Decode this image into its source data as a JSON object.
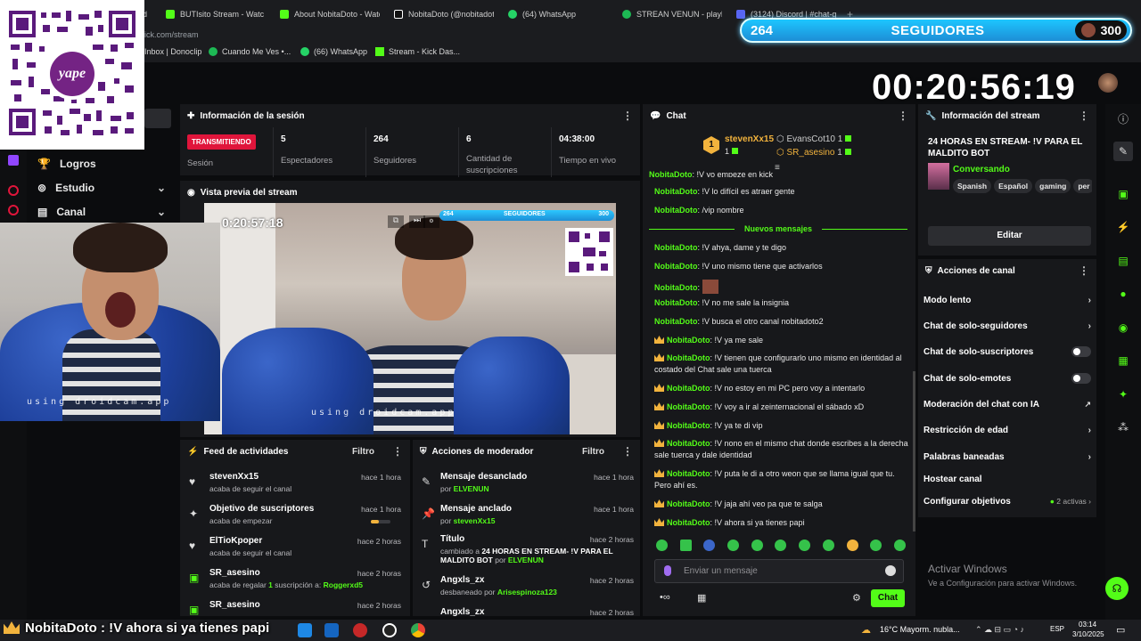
{
  "browser": {
    "tabs": [
      {
        "label": "d",
        "color": "#e8453c"
      },
      {
        "label": "BUTIsito Stream - Watch",
        "color": "#53fc18"
      },
      {
        "label": "About NobitaDoto - Watc",
        "color": "#53fc18"
      },
      {
        "label": "NobitaDoto (@nobitadoto",
        "color": "#ffffff"
      },
      {
        "label": "(64) WhatsApp",
        "color": "#25d366"
      },
      {
        "label": "STREAN VENUN - playlis",
        "color": "#1db954"
      },
      {
        "label": "(3124) Discord | #chat-g",
        "color": "#5865f2"
      }
    ],
    "address": "ick.com/stream",
    "bookmarks": [
      {
        "label": "Inbox | Donoclip",
        "color": "#888"
      },
      {
        "label": "Cuando Me Ves •...",
        "color": "#1db954"
      },
      {
        "label": "(66) WhatsApp",
        "color": "#25d366"
      },
      {
        "label": "Stream - Kick Das...",
        "color": "#53fc18"
      }
    ]
  },
  "overlay": {
    "followers": "264",
    "followers_label": "SEGUIDORES",
    "goal": "300",
    "timer": "00:20:56:19",
    "qr_brand": "yape",
    "ticker": "NobitaDoto : !V ahora si ya tienes papi"
  },
  "left_nav": {
    "items": [
      {
        "label": "Logros",
        "icon": "trophy-icon"
      },
      {
        "label": "Estudio",
        "icon": "studio-icon"
      },
      {
        "label": "Canal",
        "icon": "channel-icon"
      }
    ]
  },
  "session": {
    "title": "Información de la sesión",
    "live_badge": "TRANSMITIENDO",
    "session_label": "Sesión",
    "stats": [
      {
        "value": "5",
        "label": "Espectadores"
      },
      {
        "value": "264",
        "label": "Seguidores"
      },
      {
        "value": "6",
        "label": "Cantidad de suscripciones"
      },
      {
        "value": "04:38:00",
        "label": "Tiempo en vivo"
      }
    ]
  },
  "preview": {
    "title": "Vista previa del stream",
    "inner_followers": "264",
    "inner_label": "SEGUIDORES",
    "inner_goal": "300",
    "inner_timer": "0:20:57:18",
    "watermark": "using droidcam.app",
    "cam_watermark": "using droidcam.app"
  },
  "feed": {
    "title": "Feed de actividades",
    "filter": "Filtro",
    "items": [
      {
        "user": "stevenXx15",
        "text": "acaba de seguir el canal",
        "time": "hace 1 hora",
        "icon": "heart-icon"
      },
      {
        "user": "Objetivo de suscriptores",
        "text": "acaba de empezar",
        "time": "hace 1 hora",
        "icon": "sparkle-icon",
        "progress": 0.4
      },
      {
        "user": "ElTioKpoper",
        "text": "acaba de seguir el canal",
        "time": "hace 2 horas",
        "icon": "heart-icon"
      },
      {
        "user": "SR_asesino",
        "text_prefix": "acaba de regalar ",
        "text_highlight": "1",
        "text_mid": " suscripción a: ",
        "text_user": "Roggerxd5",
        "time": "hace 2 horas",
        "icon": "gift-icon"
      },
      {
        "user": "SR_asesino",
        "text": "",
        "time": "hace 2 horas",
        "icon": "gift-icon"
      }
    ]
  },
  "mod": {
    "title": "Acciones de moderador",
    "filter": "Filtro",
    "items": [
      {
        "title": "Mensaje desanclado",
        "by": "por ",
        "user": "ELVENUN",
        "time": "hace 1 hora",
        "icon": "unpin-icon"
      },
      {
        "title": "Mensaje anclado",
        "by": "por ",
        "user": "stevenXx15",
        "time": "hace 1 hora",
        "icon": "pin-icon"
      },
      {
        "title": "Título",
        "line1": "cambiado a ",
        "line1b": "24 HORAS EN STREAM- !V PARA EL",
        "line2": "MALDITO BOT",
        "line2b": " por ",
        "user": "ELVENUN",
        "time": "hace 2 horas",
        "icon": "title-icon"
      },
      {
        "title": "Angxls_zx",
        "by": "desbaneado por ",
        "user": "Arisespinoza123",
        "time": "hace 2 horas",
        "icon": "unban-icon"
      },
      {
        "title": "Angxls_zx",
        "by": "",
        "user": "",
        "time": "hace 2 horas",
        "icon": "unban-icon"
      }
    ]
  },
  "chat": {
    "title": "Chat",
    "top_gifter": {
      "rank": "1",
      "user": "stevenXx15",
      "count": "1"
    },
    "gifters": [
      {
        "user": "EvansCot10",
        "count": "1"
      },
      {
        "user": "SR_asesino",
        "count": "1"
      }
    ],
    "new_messages": "Nuevos mensajes",
    "messages": [
      {
        "user": "NobitaDoto",
        "text": ": !V yo empeze en kick",
        "crown": false
      },
      {
        "user": "NobitaDoto",
        "text": ": !V lo difícil es atraer gente",
        "crown": false
      },
      {
        "user": "NobitaDoto",
        "text": ": /vip nombre",
        "crown": false
      },
      {
        "user": "NobitaDoto",
        "text": ": !V ahya, dame y te digo",
        "crown": false
      },
      {
        "user": "NobitaDoto",
        "text": ": !V uno mismo tiene que activarlos",
        "crown": false
      },
      {
        "user": "NobitaDoto",
        "text": ":",
        "crown": false,
        "emote": true
      },
      {
        "user": "NobitaDoto",
        "text": ": !V no me sale la insignia",
        "crown": false
      },
      {
        "user": "NobitaDoto",
        "text": ": !V busca el otro canal nobitadoto2",
        "crown": false
      },
      {
        "user": "NobitaDoto",
        "text": ": !V ya me sale",
        "crown": true
      },
      {
        "user": "NobitaDoto",
        "text": ": !V tienen que configurarlo uno mismo en identidad al costado del Chat sale una tuerca",
        "crown": true
      },
      {
        "user": "NobitaDoto",
        "text": ": !V no estoy en mi PC pero voy a intentarlo",
        "crown": true
      },
      {
        "user": "NobitaDoto",
        "text": ": !V voy a ir al zeinternacional el sábado xD",
        "crown": true
      },
      {
        "user": "NobitaDoto",
        "text": ": !V ya te di vip",
        "crown": true
      },
      {
        "user": "NobitaDoto",
        "text": ": !V nono en el mismo chat donde escribes a la derecha sale tuerca y dale identidad",
        "crown": true
      },
      {
        "user": "NobitaDoto",
        "text": ": !V puta le di a otro weon que se llama igual que tu. Pero ahí es.",
        "crown": true
      },
      {
        "user": "NobitaDoto",
        "text": ": !V jaja ahí veo pa que te salga",
        "crown": true
      },
      {
        "user": "NobitaDoto",
        "text": ": !V ahora si ya tienes papi",
        "crown": true
      }
    ],
    "input_placeholder": "Enviar un mensaje",
    "send_label": "Chat"
  },
  "stream_info": {
    "title": "Información del stream",
    "stream_title": "24 HORAS EN STREAM- !V PARA EL MALDITO BOT",
    "category": "Conversando",
    "tags": [
      "Spanish",
      "Español",
      "gaming",
      "per"
    ],
    "edit_label": "Editar"
  },
  "channel_actions": {
    "title": "Acciones de canal",
    "items": [
      {
        "label": "Modo lento",
        "control": "chevron"
      },
      {
        "label": "Chat de solo-seguidores",
        "control": "chevron"
      },
      {
        "label": "Chat de solo-suscriptores",
        "control": "toggle"
      },
      {
        "label": "Chat de solo-emotes",
        "control": "toggle"
      },
      {
        "label": "Moderación del chat con IA",
        "control": "external"
      },
      {
        "label": "Restricción de edad",
        "control": "chevron"
      },
      {
        "label": "Palabras baneadas",
        "control": "chevron"
      },
      {
        "label": "Hostear canal",
        "control": "none"
      },
      {
        "label": "Configurar objetivos",
        "control": "chevron",
        "badge": "2 activas"
      }
    ]
  },
  "windows": {
    "activate_title": "Activar Windows",
    "activate_sub": "Ve a Configuración para activar Windows.",
    "weather": "16°C  Mayorm. nubla...",
    "lang": "ESP",
    "time": "03:14",
    "date": "3/10/2025"
  },
  "colors": {
    "accent": "#53fc18",
    "live": "#e0153b",
    "panel": "#17181b",
    "bg": "#0b0c0e"
  }
}
